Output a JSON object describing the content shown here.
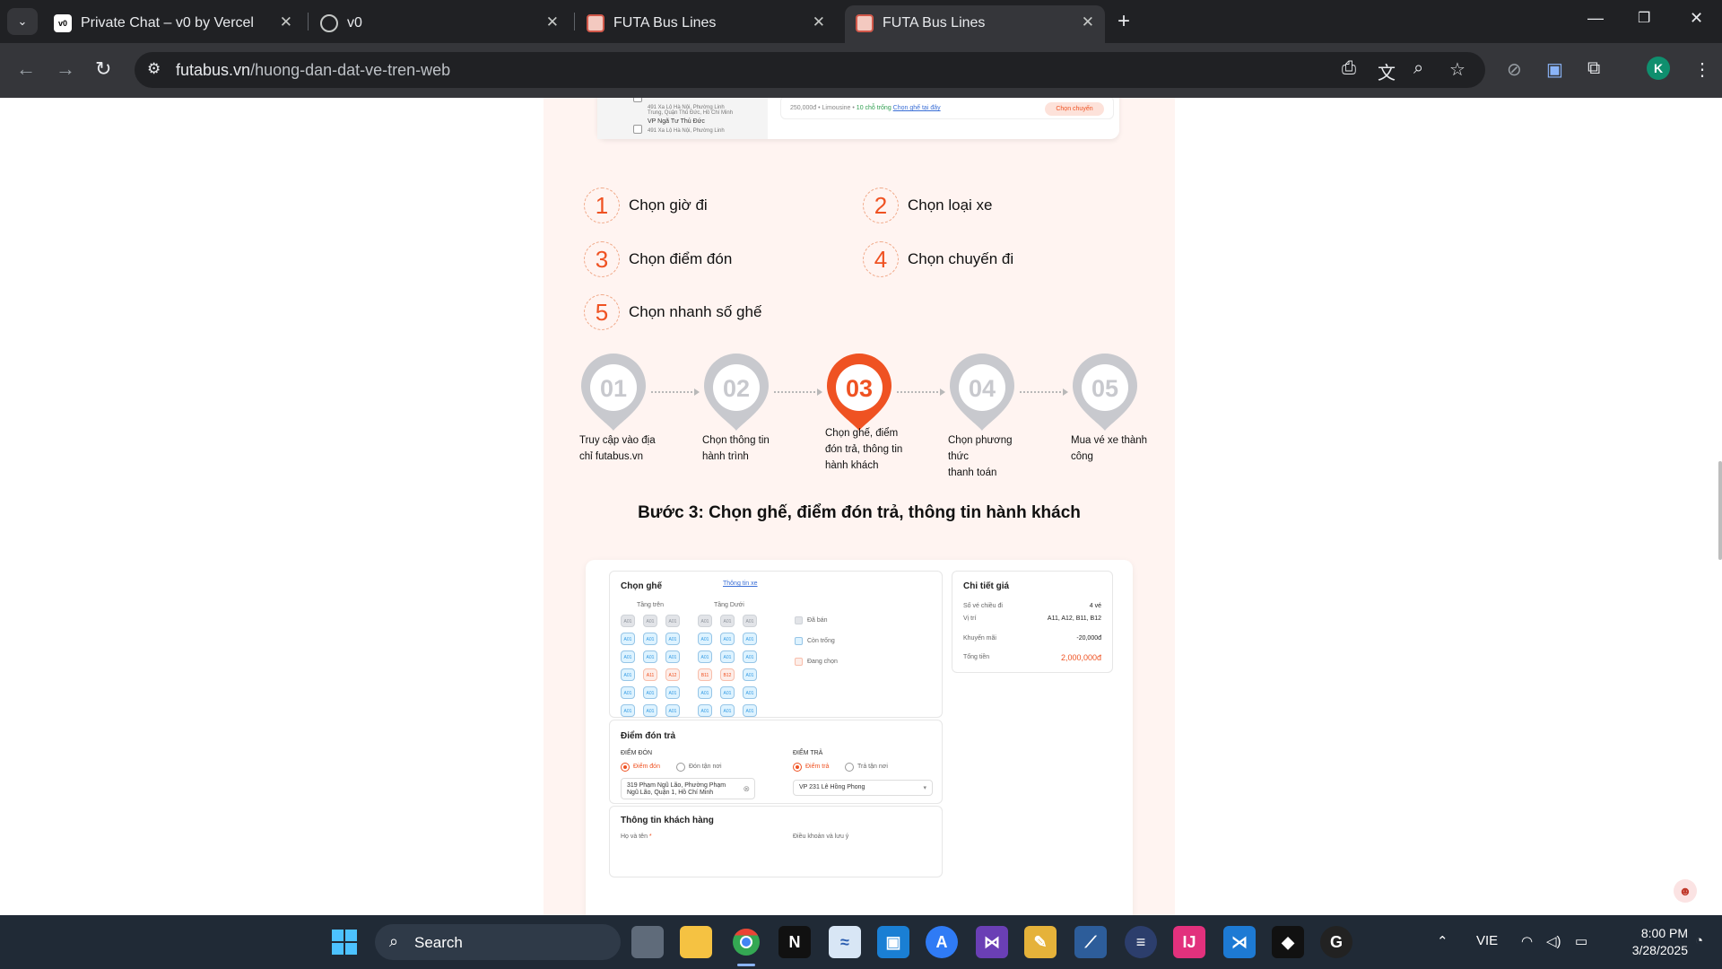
{
  "browser": {
    "tabs": [
      {
        "title": "Private Chat – v0 by Vercel",
        "favicon": "v0-icon"
      },
      {
        "title": "v0",
        "favicon": "globe-icon"
      },
      {
        "title": "FUTA Bus Lines",
        "favicon": "futa-icon"
      },
      {
        "title": "FUTA Bus Lines",
        "favicon": "futa-icon"
      }
    ],
    "url_domain": "futabus.vn",
    "url_path": "/huong-dan-dat-ve-tren-web",
    "profile_initial": "K"
  },
  "top_card": {
    "left_items": [
      {
        "text": "491 Xa Lộ Hà Nội, Phường Linh"
      },
      {
        "text": "Trung, Quận Thủ Đức, Hồ Chí Minh"
      },
      {
        "text": "VP Ngã Tư Thủ Đức"
      },
      {
        "text": "491 Xa Lộ Hà Nội, Phường Linh"
      }
    ],
    "price_info": "250,000đ • Limousine •",
    "seats_left": "10 chỗ trống",
    "seat_link": "Chọn ghế tại đây",
    "select_button": "Chọn chuyến"
  },
  "numbered_items": [
    {
      "num": "1",
      "label": "Chọn giờ đi"
    },
    {
      "num": "2",
      "label": "Chọn loại xe"
    },
    {
      "num": "3",
      "label": "Chọn điểm đón"
    },
    {
      "num": "4",
      "label": "Chọn chuyến đi"
    },
    {
      "num": "5",
      "label": "Chọn nhanh số ghế"
    }
  ],
  "steps": [
    {
      "num": "01",
      "line1": "Truy cập vào địa",
      "line2": "chỉ futabus.vn",
      "line3": "",
      "active": false
    },
    {
      "num": "02",
      "line1": "Chọn thông tin",
      "line2": "hành trình",
      "line3": "",
      "active": false
    },
    {
      "num": "03",
      "line1": "Chọn ghế, điểm",
      "line2": "đón trả, thông tin",
      "line3": "hành khách",
      "active": true
    },
    {
      "num": "04",
      "line1": "Chọn phương thức",
      "line2": "thanh toán",
      "line3": "",
      "active": false
    },
    {
      "num": "05",
      "line1": "Mua vé xe thành",
      "line2": "công",
      "line3": "",
      "active": false
    }
  ],
  "section_heading": "Bước 3: Chọn ghế, điểm đón trả, thông tin hành khách",
  "seat_panel": {
    "title": "Chọn ghế",
    "info_link": "Thông tin xe",
    "upper_label": "Tầng trên",
    "lower_label": "Tầng Dưới",
    "seat_label": "A01",
    "legend": [
      "Đã bán",
      "Còn trống",
      "Đang chọn"
    ],
    "selected": [
      "A11",
      "A12",
      "B11",
      "B12"
    ]
  },
  "price_panel": {
    "title": "Chi tiết giá",
    "rows": [
      {
        "label": "Số vé chiều đi",
        "value": "4 vé"
      },
      {
        "label": "Vị trí",
        "value": "A11, A12, B11, B12"
      },
      {
        "label": "Khuyến mãi",
        "value": "-20,000đ"
      },
      {
        "label": "Tổng tiền",
        "value": "2,000,000đ"
      }
    ]
  },
  "pickup_panel": {
    "title": "Điểm đón trả",
    "pickup_header": "ĐIỂM ĐÓN",
    "dropoff_header": "ĐIỂM TRẢ",
    "pickup_opt1": "Điểm đón",
    "pickup_opt2": "Đón tận nơi",
    "dropoff_opt1": "Điểm trả",
    "dropoff_opt2": "Trả tận nơi",
    "pickup_value_1": "319 Phạm Ngũ Lão, Phường Phạm",
    "pickup_value_2": "Ngũ Lão, Quận 1, Hồ Chí Minh",
    "dropoff_value": "VP 231 Lê Hồng Phong"
  },
  "customer_panel": {
    "title": "Thông tin khách hàng",
    "name_label": "Họ và tên",
    "terms_label": "Điều khoản và lưu ý"
  },
  "taskbar": {
    "search_label": "Search",
    "lang": "VIE",
    "time": "8:00 PM",
    "date": "3/28/2025"
  }
}
